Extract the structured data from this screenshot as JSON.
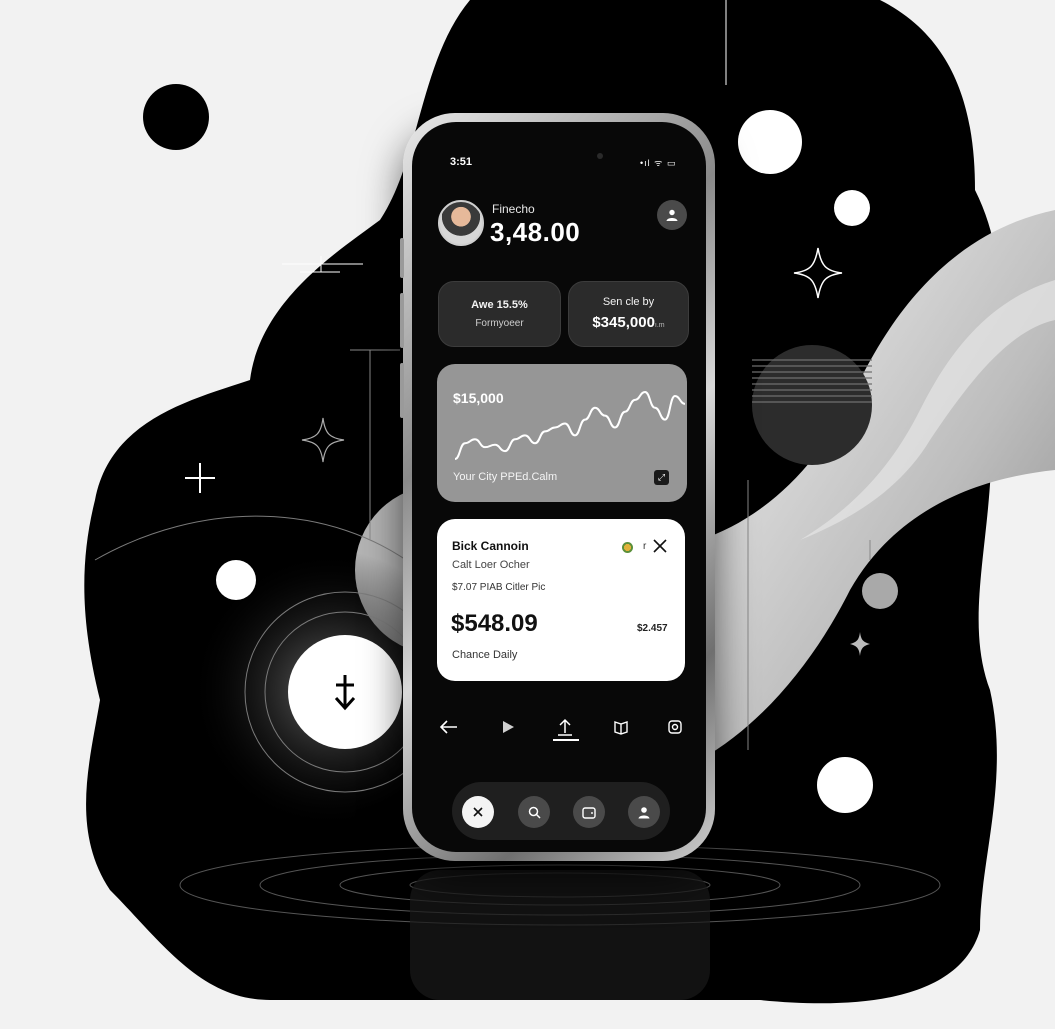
{
  "status_bar": {
    "time": "3:51",
    "icons": "•ıl ᯤ ▭"
  },
  "header": {
    "account_name": "Finecho",
    "balance": "3,48.00"
  },
  "stats": [
    {
      "top": "Awe 15.5%",
      "bottom": "Formyoeer"
    },
    {
      "top": "Sen cle by",
      "value": "$345,000",
      "unit": "ı.m"
    }
  ],
  "chart_card": {
    "value_label": "$15,000",
    "footer": "Your City PPEd.Calm",
    "badge_icon": "expand-icon"
  },
  "chart_data": {
    "type": "line",
    "title": "",
    "x": [
      0,
      1,
      2,
      3,
      4,
      5,
      6,
      7,
      8,
      9,
      10,
      11,
      12,
      13,
      14,
      15,
      16,
      17,
      18,
      19,
      20,
      21,
      22,
      23
    ],
    "series": [
      {
        "values": [
          3,
          5,
          5.5,
          4.5,
          4.8,
          4,
          5.5,
          6,
          5,
          6.5,
          7,
          7.5,
          6,
          8,
          9.5,
          8.5,
          7,
          9,
          10.5,
          11.5,
          9.5,
          8,
          11,
          10
        ]
      }
    ]
  },
  "transaction": {
    "title": "Bick Cannoin",
    "subtitle": "Calt Loer Ocher",
    "detail": "$7.07 PIAB Citler Pic",
    "amount": "$548.09",
    "side_amount": "$2.457",
    "note": "Chance Daily",
    "badge_text": "r"
  },
  "action_row": {
    "items": [
      "back-arrow-icon",
      "play-icon",
      "upload-icon",
      "book-icon",
      "camera-icon"
    ],
    "active_index": 2
  },
  "dock": {
    "items": [
      "close-icon",
      "search-icon",
      "wallet-icon",
      "profile-icon"
    ],
    "active_index": 0
  },
  "colors": {
    "screen_bg": "#080808",
    "card_dark": "#2b2b2b",
    "chart_card_bg": "#969696",
    "tx_card_bg": "#ffffff",
    "accent": "#ffffff"
  }
}
